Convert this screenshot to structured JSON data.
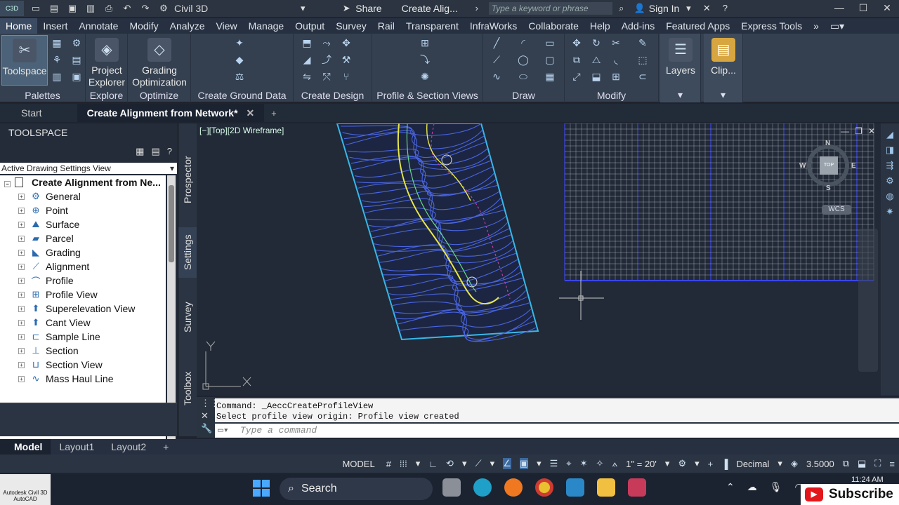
{
  "titlebar": {
    "app_badge": "C3D",
    "workspace": "Civil 3D",
    "share_label": "Share",
    "doc_title": "Create Alig...",
    "search_placeholder": "Type a keyword or phrase",
    "signin_label": "Sign In"
  },
  "menu": {
    "items": [
      "Home",
      "Insert",
      "Annotate",
      "Modify",
      "Analyze",
      "View",
      "Manage",
      "Output",
      "Survey",
      "Rail",
      "Transparent",
      "InfraWorks",
      "Collaborate",
      "Help",
      "Add-ins",
      "Featured Apps",
      "Express Tools"
    ]
  },
  "ribbon": {
    "toolspace_label": "Toolspace",
    "palettes_label": "Palettes",
    "project_explorer_label": "Project Explorer",
    "explore_label": "Explore",
    "grading_optimization_label": "Grading Optimization",
    "optimize_label": "Optimize",
    "create_ground_data_label": "Create Ground Data",
    "create_design_label": "Create Design",
    "profile_section_label": "Profile & Section Views",
    "draw_label": "Draw",
    "modify_label": "Modify",
    "layers_label": "Layers",
    "clip_label": "Clip..."
  },
  "doctabs": {
    "start": "Start",
    "active": "Create Alignment from Network*"
  },
  "toolspace": {
    "title": "TOOLSPACE",
    "view_select": "Active Drawing Settings View",
    "root": "Create Alignment from Ne...",
    "items": [
      {
        "label": "General",
        "icon": "gear-icon"
      },
      {
        "label": "Point",
        "icon": "point-icon"
      },
      {
        "label": "Surface",
        "icon": "surface-icon"
      },
      {
        "label": "Parcel",
        "icon": "parcel-icon"
      },
      {
        "label": "Grading",
        "icon": "grading-icon"
      },
      {
        "label": "Alignment",
        "icon": "alignment-icon"
      },
      {
        "label": "Profile",
        "icon": "profile-icon"
      },
      {
        "label": "Profile View",
        "icon": "profile-view-icon"
      },
      {
        "label": "Superelevation View",
        "icon": "superelevation-icon"
      },
      {
        "label": "Cant View",
        "icon": "cant-icon"
      },
      {
        "label": "Sample Line",
        "icon": "sample-line-icon"
      },
      {
        "label": "Section",
        "icon": "section-icon"
      },
      {
        "label": "Section View",
        "icon": "section-view-icon"
      },
      {
        "label": "Mass Haul Line",
        "icon": "mass-haul-icon"
      }
    ],
    "side_tabs": [
      "Prospector",
      "Settings",
      "Survey",
      "Toolbox"
    ]
  },
  "viewport": {
    "label": "[−][Top][2D Wireframe]",
    "viewcube": {
      "top": "TOP",
      "n": "N",
      "s": "S",
      "e": "E",
      "w": "W"
    },
    "wcs": "WCS"
  },
  "command": {
    "history": [
      "Command: _AeccCreateProfileView",
      "Select profile view origin: Profile view created"
    ],
    "placeholder": "Type a command"
  },
  "layouts": {
    "items": [
      "Model",
      "Layout1",
      "Layout2"
    ]
  },
  "statusbar": {
    "model": "MODEL",
    "scale": "1\" = 20'",
    "units": "Decimal",
    "elevation": "3.5000"
  },
  "taskbar": {
    "app_tile": "Autodesk Civil 3D AutoCAD",
    "search_label": "Search",
    "time": "11:24 AM",
    "subscribe": "Subscribe"
  },
  "colors": {
    "contour_blue": "#4a64e0",
    "alignment_yellow": "#e8e84a",
    "boundary_cyan": "#38b8e8",
    "grid_white": "#c8ccd4"
  }
}
